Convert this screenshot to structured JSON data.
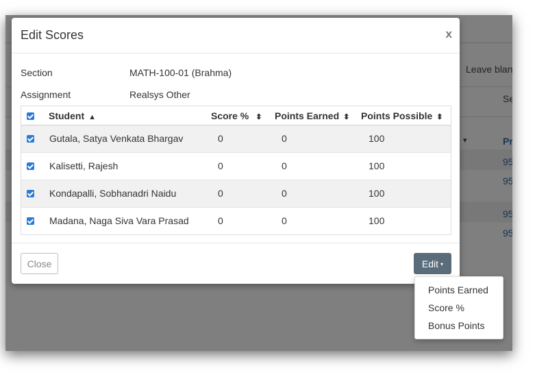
{
  "background": {
    "leave_blank_text": "Leave blan",
    "se_text": "Se",
    "col_fragment": "Pr",
    "col_caret": "▾",
    "link_values": [
      "95",
      "95",
      "95",
      "95"
    ]
  },
  "modal": {
    "title": "Edit Scores",
    "close_glyph": "x",
    "section_label": "Section",
    "section_value": "MATH-100-01 (Brahma)",
    "assignment_label": "Assignment",
    "assignment_value": "Realsys Other",
    "columns": {
      "student": "Student",
      "student_sort": "▲",
      "score_pct": "Score %",
      "points_earned": "Points Earned",
      "points_possible": "Points Possible",
      "sort_both": "⬍"
    },
    "rows": [
      {
        "student": "Gutala, Satya Venkata Bhargav",
        "score_pct": "0",
        "points_earned": "0",
        "points_possible": "100"
      },
      {
        "student": "Kalisetti, Rajesh",
        "score_pct": "0",
        "points_earned": "0",
        "points_possible": "100"
      },
      {
        "student": "Kondapalli, Sobhanadri Naidu",
        "score_pct": "0",
        "points_earned": "0",
        "points_possible": "100"
      },
      {
        "student": "Madana, Naga Siva Vara Prasad",
        "score_pct": "0",
        "points_earned": "0",
        "points_possible": "100"
      }
    ],
    "close_button": "Close",
    "edit_button": "Edit",
    "edit_caret": "▾"
  },
  "dropdown": {
    "items": [
      "Points Earned",
      "Score %",
      "Bonus Points"
    ]
  },
  "colors": {
    "checkbox": "#2a7bd6",
    "edit_button": "#5a6c7a",
    "link": "#2a6db0"
  }
}
